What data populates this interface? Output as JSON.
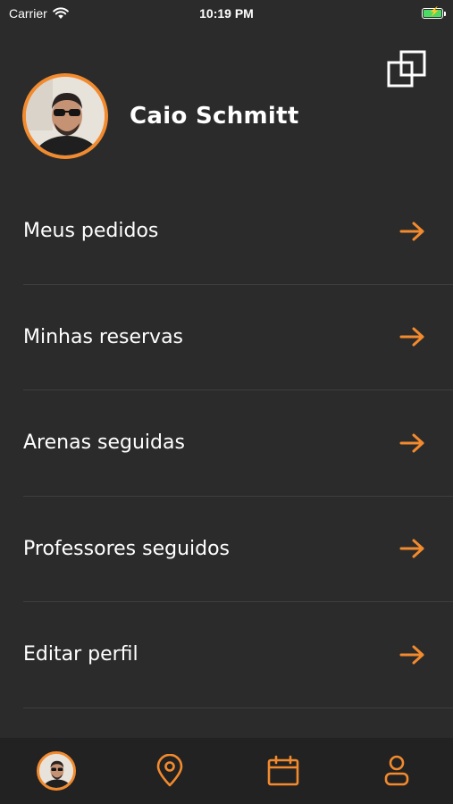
{
  "status_bar": {
    "carrier": "Carrier",
    "time": "10:19 PM"
  },
  "profile": {
    "name": "Caio Schmitt"
  },
  "menu": {
    "items": [
      {
        "label": "Meus pedidos"
      },
      {
        "label": "Minhas reservas"
      },
      {
        "label": "Arenas seguidas"
      },
      {
        "label": "Professores seguidos"
      },
      {
        "label": "Editar perfil"
      }
    ]
  },
  "tab_bar": {
    "items": [
      {
        "icon": "avatar-icon"
      },
      {
        "icon": "location-pin-icon"
      },
      {
        "icon": "calendar-icon"
      },
      {
        "icon": "user-icon"
      }
    ]
  },
  "colors": {
    "accent": "#f28a2e",
    "background": "#2b2b2b",
    "tab_bar": "#222222"
  }
}
